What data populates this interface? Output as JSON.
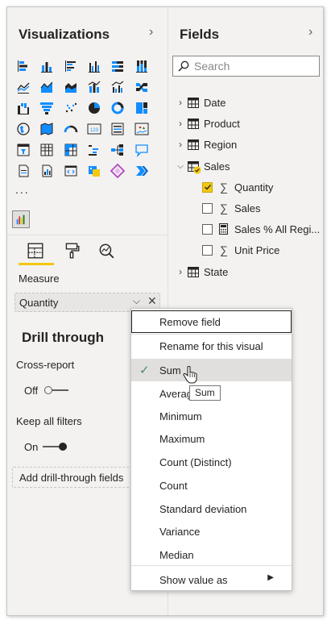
{
  "visualizations": {
    "title": "Visualizations",
    "more": "...",
    "subtabs": [
      "fields-tab",
      "format-tab",
      "analytics-tab"
    ],
    "well_label": "Measure",
    "well_value": "Quantity",
    "drill": {
      "title": "Drill through",
      "cross_report_label": "Cross-report",
      "cross_report_state": "Off",
      "keep_filters_label": "Keep all filters",
      "keep_filters_state": "On",
      "add_label": "Add drill-through fields"
    },
    "icons": [
      [
        "stacked-bar-chart-icon",
        "stacked-column-chart-icon",
        "clustered-bar-chart-icon",
        "clustered-column-chart-icon",
        "100-stacked-bar-chart-icon",
        "100-stacked-column-chart-icon"
      ],
      [
        "line-chart-icon",
        "area-chart-icon",
        "stacked-area-chart-icon",
        "line-and-stacked-column-chart-icon",
        "line-and-clustered-column-chart-icon",
        "ribbon-chart-icon"
      ],
      [
        "waterfall-chart-icon",
        "funnel-chart-icon",
        "scatter-chart-icon",
        "pie-chart-icon",
        "donut-chart-icon",
        "treemap-icon"
      ],
      [
        "map-icon",
        "filled-map-icon",
        "gauge-icon",
        "card-icon",
        "multi-row-card-icon",
        "kpi-icon"
      ],
      [
        "slicer-icon",
        "table-icon",
        "matrix-icon",
        "key-influencers-icon",
        "decomposition-tree-icon",
        "qa-icon"
      ],
      [
        "smart-narrative-icon",
        "paginated-report-icon",
        "r-script-visual-icon",
        "python-visual-icon",
        "power-apps-icon",
        "power-automate-icon"
      ]
    ]
  },
  "fields": {
    "title": "Fields",
    "search_placeholder": "Search",
    "tables": [
      {
        "name": "Date",
        "expanded": false
      },
      {
        "name": "Product",
        "expanded": false
      },
      {
        "name": "Region",
        "expanded": false
      },
      {
        "name": "Sales",
        "expanded": true
      },
      {
        "name": "State",
        "expanded": false
      }
    ],
    "sales_fields": [
      {
        "name": "Quantity",
        "checked": true,
        "kind": "sigma"
      },
      {
        "name": "Sales",
        "checked": false,
        "kind": "sigma"
      },
      {
        "name": "Sales % All Regi...",
        "checked": false,
        "kind": "calc"
      },
      {
        "name": "Unit Price",
        "checked": false,
        "kind": "sigma"
      }
    ]
  },
  "context_menu": {
    "items": [
      "Remove field",
      "Rename for this visual",
      "Sum",
      "Average",
      "Minimum",
      "Maximum",
      "Count (Distinct)",
      "Count",
      "Standard deviation",
      "Variance",
      "Median",
      "Show value as"
    ],
    "selected": "Sum",
    "tooltip": "Sum"
  },
  "colors": {
    "accent_yellow": "#f2c811",
    "icon_blue": "#118dff",
    "check_green": "#4a8a6e",
    "pane_bg": "#f3f2f1"
  }
}
